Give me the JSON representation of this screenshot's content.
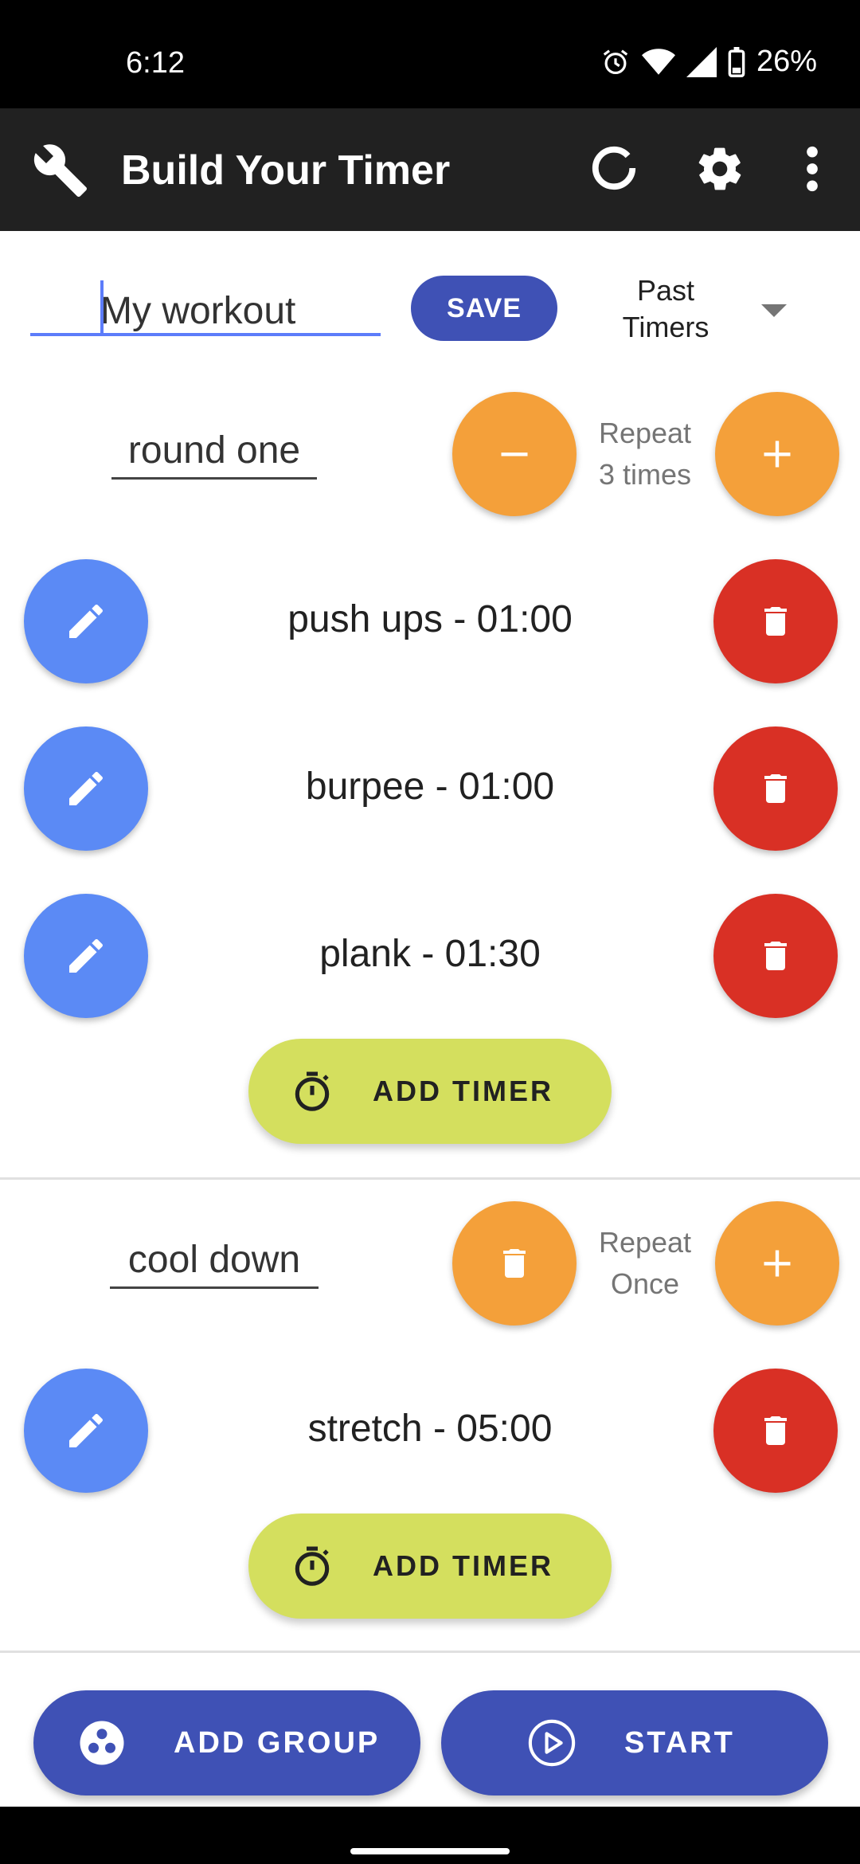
{
  "status_bar": {
    "time": "6:12",
    "battery": "26%"
  },
  "app_bar": {
    "title": "Build Your Timer"
  },
  "workout": {
    "name": "My workout",
    "save_label": "SAVE",
    "past_timers_line1": "Past",
    "past_timers_line2": "Timers"
  },
  "groups": [
    {
      "name": "round one",
      "repeat_line1": "Repeat",
      "repeat_line2": "3 times",
      "timers": [
        {
          "label": "push ups - 01:00"
        },
        {
          "label": "burpee - 01:00"
        },
        {
          "label": "plank - 01:30"
        }
      ],
      "add_timer_label": "ADD TIMER"
    },
    {
      "name": "cool down",
      "repeat_line1": "Repeat",
      "repeat_line2": "Once",
      "timers": [
        {
          "label": "stretch - 05:00"
        }
      ],
      "add_timer_label": "ADD TIMER"
    }
  ],
  "bottom": {
    "add_group_label": "ADD GROUP",
    "start_label": "START"
  },
  "colors": {
    "app_bar": "#212121",
    "primary": "#3f51b5",
    "orange": "#f4a03a",
    "edit_blue": "#5b8af5",
    "delete_red": "#d93025",
    "add_timer": "#d4df5e"
  },
  "icons": [
    "wrench-icon",
    "refresh-icon",
    "gear-icon",
    "more-vert-icon",
    "minus-icon",
    "plus-icon",
    "pencil-icon",
    "trash-icon",
    "stopwatch-icon",
    "group-icon",
    "play-icon"
  ]
}
